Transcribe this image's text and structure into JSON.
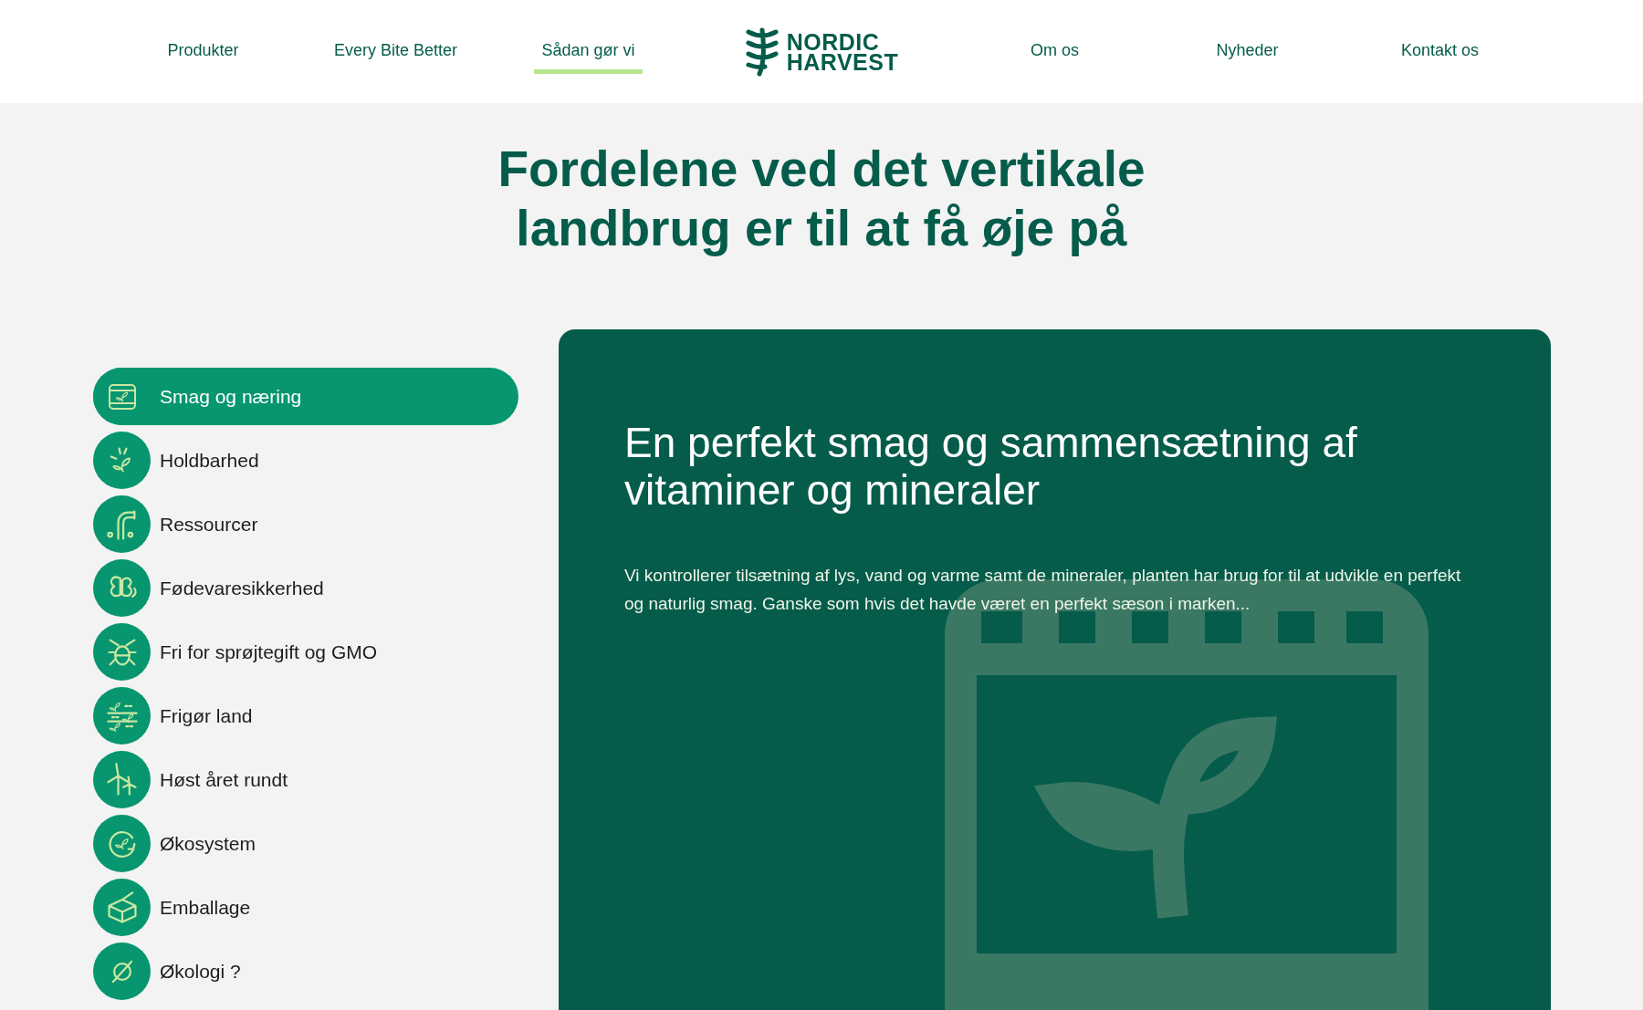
{
  "nav": [
    {
      "label": "Produkter",
      "selected": false
    },
    {
      "label": "Every Bite Better",
      "selected": false
    },
    {
      "label": "Sådan gør vi",
      "selected": true
    },
    {
      "label": "Om os",
      "selected": false
    },
    {
      "label": "Nyheder",
      "selected": false
    },
    {
      "label": "Kontakt os",
      "selected": false
    }
  ],
  "logo": {
    "line_1": "NORDIC",
    "line_2": "HARVEST"
  },
  "title": "Fordelene ved det vertikale landbrug er til at få øje på",
  "topics": [
    {
      "label": "Smag og næring",
      "selected": true
    },
    {
      "label": "Holdbarhed",
      "selected": false
    },
    {
      "label": "Ressourcer",
      "selected": false
    },
    {
      "label": "Fødevaresikkerhed",
      "selected": false
    },
    {
      "label": "Fri for sprøjtegift og GMO",
      "selected": false
    },
    {
      "label": "Frigør land",
      "selected": false
    },
    {
      "label": "Høst året rundt",
      "selected": false
    },
    {
      "label": "Økosystem",
      "selected": false
    },
    {
      "label": "Emballage",
      "selected": false
    },
    {
      "label": "Økologi ?",
      "selected": false
    }
  ],
  "detail": {
    "heading": "En perfekt smag og sammensætning af vitaminer og mineraler",
    "text": "Vi kontrollerer tilsætning af lys, vand og varme samt de mineraler, planten har brug for til at udvikle en perfekt og naturlig smag. Ganske som hvis det havde været en perfekt sæson i marken..."
  }
}
